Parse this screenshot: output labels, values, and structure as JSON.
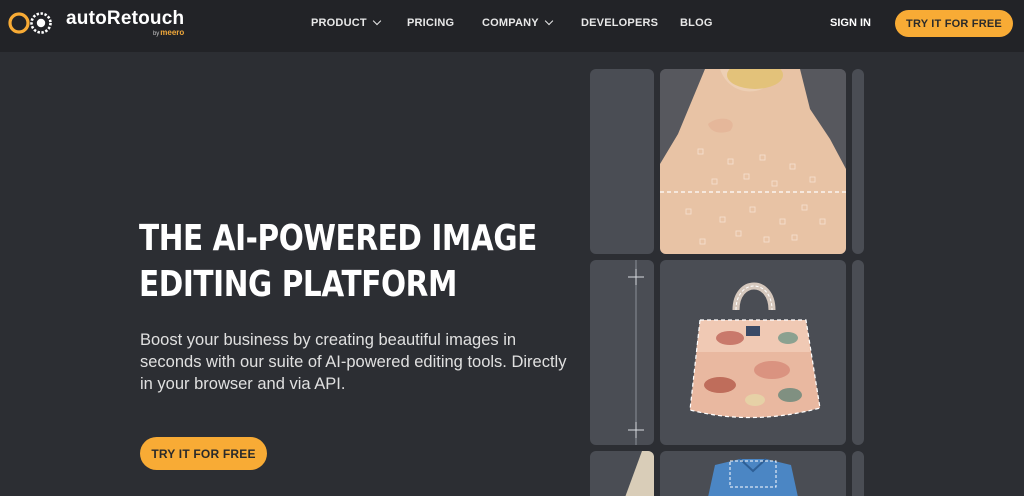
{
  "nav": {
    "brand": "autoRetouch",
    "byline_by": "by",
    "byline_name": "meero",
    "items": [
      {
        "label": "PRODUCT",
        "has_dropdown": true
      },
      {
        "label": "PRICING",
        "has_dropdown": false
      },
      {
        "label": "COMPANY",
        "has_dropdown": true
      },
      {
        "label": "DEVELOPERS",
        "has_dropdown": false
      },
      {
        "label": "BLOG",
        "has_dropdown": false
      }
    ],
    "sign_in": "SIGN IN",
    "cta": "TRY IT FOR FREE"
  },
  "hero": {
    "title_lines": [
      "THE AI-POWERED IMAGE",
      "EDITING PLATFORM"
    ],
    "subtitle_lines": [
      "Boost your business by creating beautiful images in",
      "seconds with our suite of AI-powered editing tools. Directly",
      "in your browser and via API."
    ],
    "cta": "TRY IT FOR FREE"
  },
  "gallery": {
    "icons": [
      "skin-retouch-example-image",
      "background-removal-bag-image",
      "shirt-example-image"
    ]
  },
  "colors": {
    "accent": "#f8ab35",
    "nav_bg": "#222327",
    "page_bg": "#2c2e33",
    "tile_bg": "#4a4d54"
  }
}
